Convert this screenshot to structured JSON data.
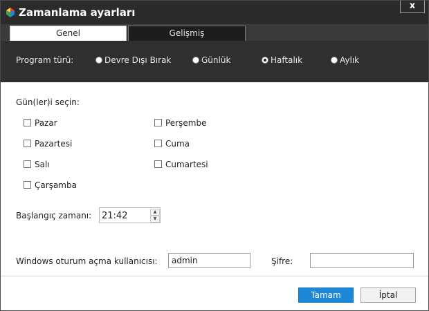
{
  "window": {
    "title": "Zamanlama ayarları",
    "close_label": "x"
  },
  "tabs": [
    {
      "label": "Genel",
      "active": true
    },
    {
      "label": "Gelişmiş",
      "active": false
    }
  ],
  "program_type": {
    "label": "Program türü:",
    "options": [
      {
        "label": "Devre Dışı Bırak",
        "selected": false
      },
      {
        "label": "Günlük",
        "selected": false
      },
      {
        "label": "Haftalık",
        "selected": true
      },
      {
        "label": "Aylık",
        "selected": false
      }
    ]
  },
  "days": {
    "label": "Gün(ler)i seçin:",
    "items": [
      {
        "label": "Pazar",
        "checked": false
      },
      {
        "label": "Pazartesi",
        "checked": false
      },
      {
        "label": "Salı",
        "checked": false
      },
      {
        "label": "Çarşamba",
        "checked": false
      },
      {
        "label": "Perşembe",
        "checked": false
      },
      {
        "label": "Cuma",
        "checked": false
      },
      {
        "label": "Cumartesi",
        "checked": false
      }
    ]
  },
  "start_time": {
    "label": "Başlangıç zamanı:",
    "value": "21:42"
  },
  "login": {
    "user_label": "Windows oturum açma kullanıcısı:",
    "user_value": "admin",
    "password_label": "Şifre:",
    "password_value": ""
  },
  "buttons": {
    "ok": "Tamam",
    "cancel": "İptal"
  },
  "colors": {
    "titlebar": "#2b2b2b",
    "typebar": "#2f2f2f",
    "accent": "#1e88d8"
  }
}
